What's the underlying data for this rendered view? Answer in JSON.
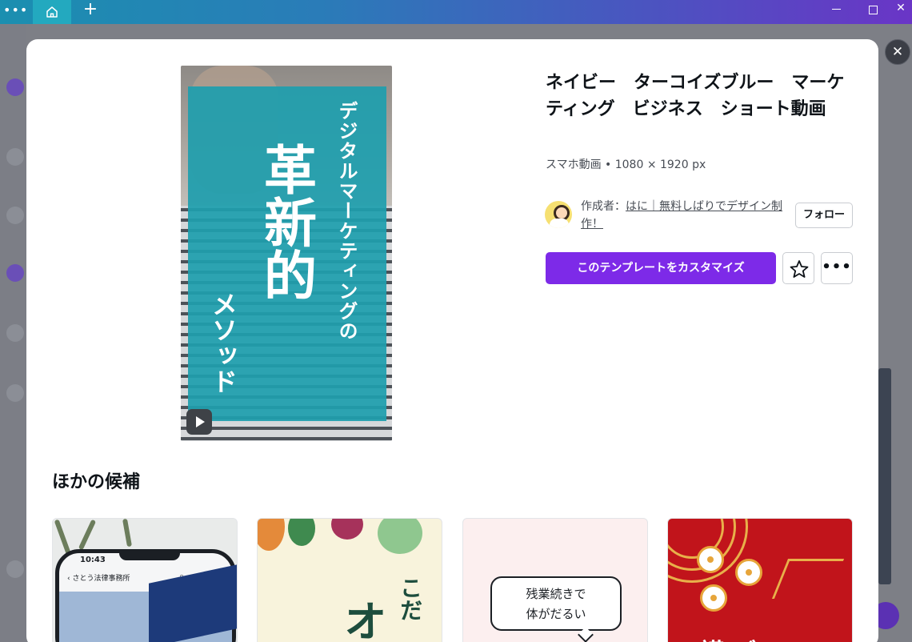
{
  "window": {
    "menu_icon": "dots-icon",
    "home_icon": "home-icon",
    "new_tab_label": "+"
  },
  "modal": {
    "close_label": "✕",
    "preview": {
      "line1": "デジタルマーケティングの",
      "line2": "革新的",
      "line3": "メソッド",
      "play_icon": "play-icon"
    },
    "title": "ネイビー　ターコイズブルー　マーケティング　ビジネス　ショート動画",
    "meta": "スマホ動画 • 1080 × 1920 px",
    "author_prefix": "作成者：",
    "author_name": "はに｜無料しばりでデザイン制作！",
    "follow_label": "フォロー",
    "customize_label": "このテンプレートをカスタマイズ",
    "star_icon": "star-icon",
    "more_label": "•••",
    "section_title": "ほかの候補",
    "cards": [
      {
        "phone_time": "10:43",
        "phone_status": "",
        "phone_nav": "‹  さとう法律事務所",
        "phone_icons": "⌕ ▯ ☰"
      },
      {
        "text_large": "オ",
        "text_small": "こだ"
      },
      {
        "bubble_line1": "残業続きで",
        "bubble_line2": "体がだるい"
      },
      {
        "text_bottom": "謹 ご"
      }
    ]
  },
  "colors": {
    "accent": "#7d2ae8",
    "preview_panel": "#1f9ead",
    "card4_bg": "#c1141b"
  }
}
